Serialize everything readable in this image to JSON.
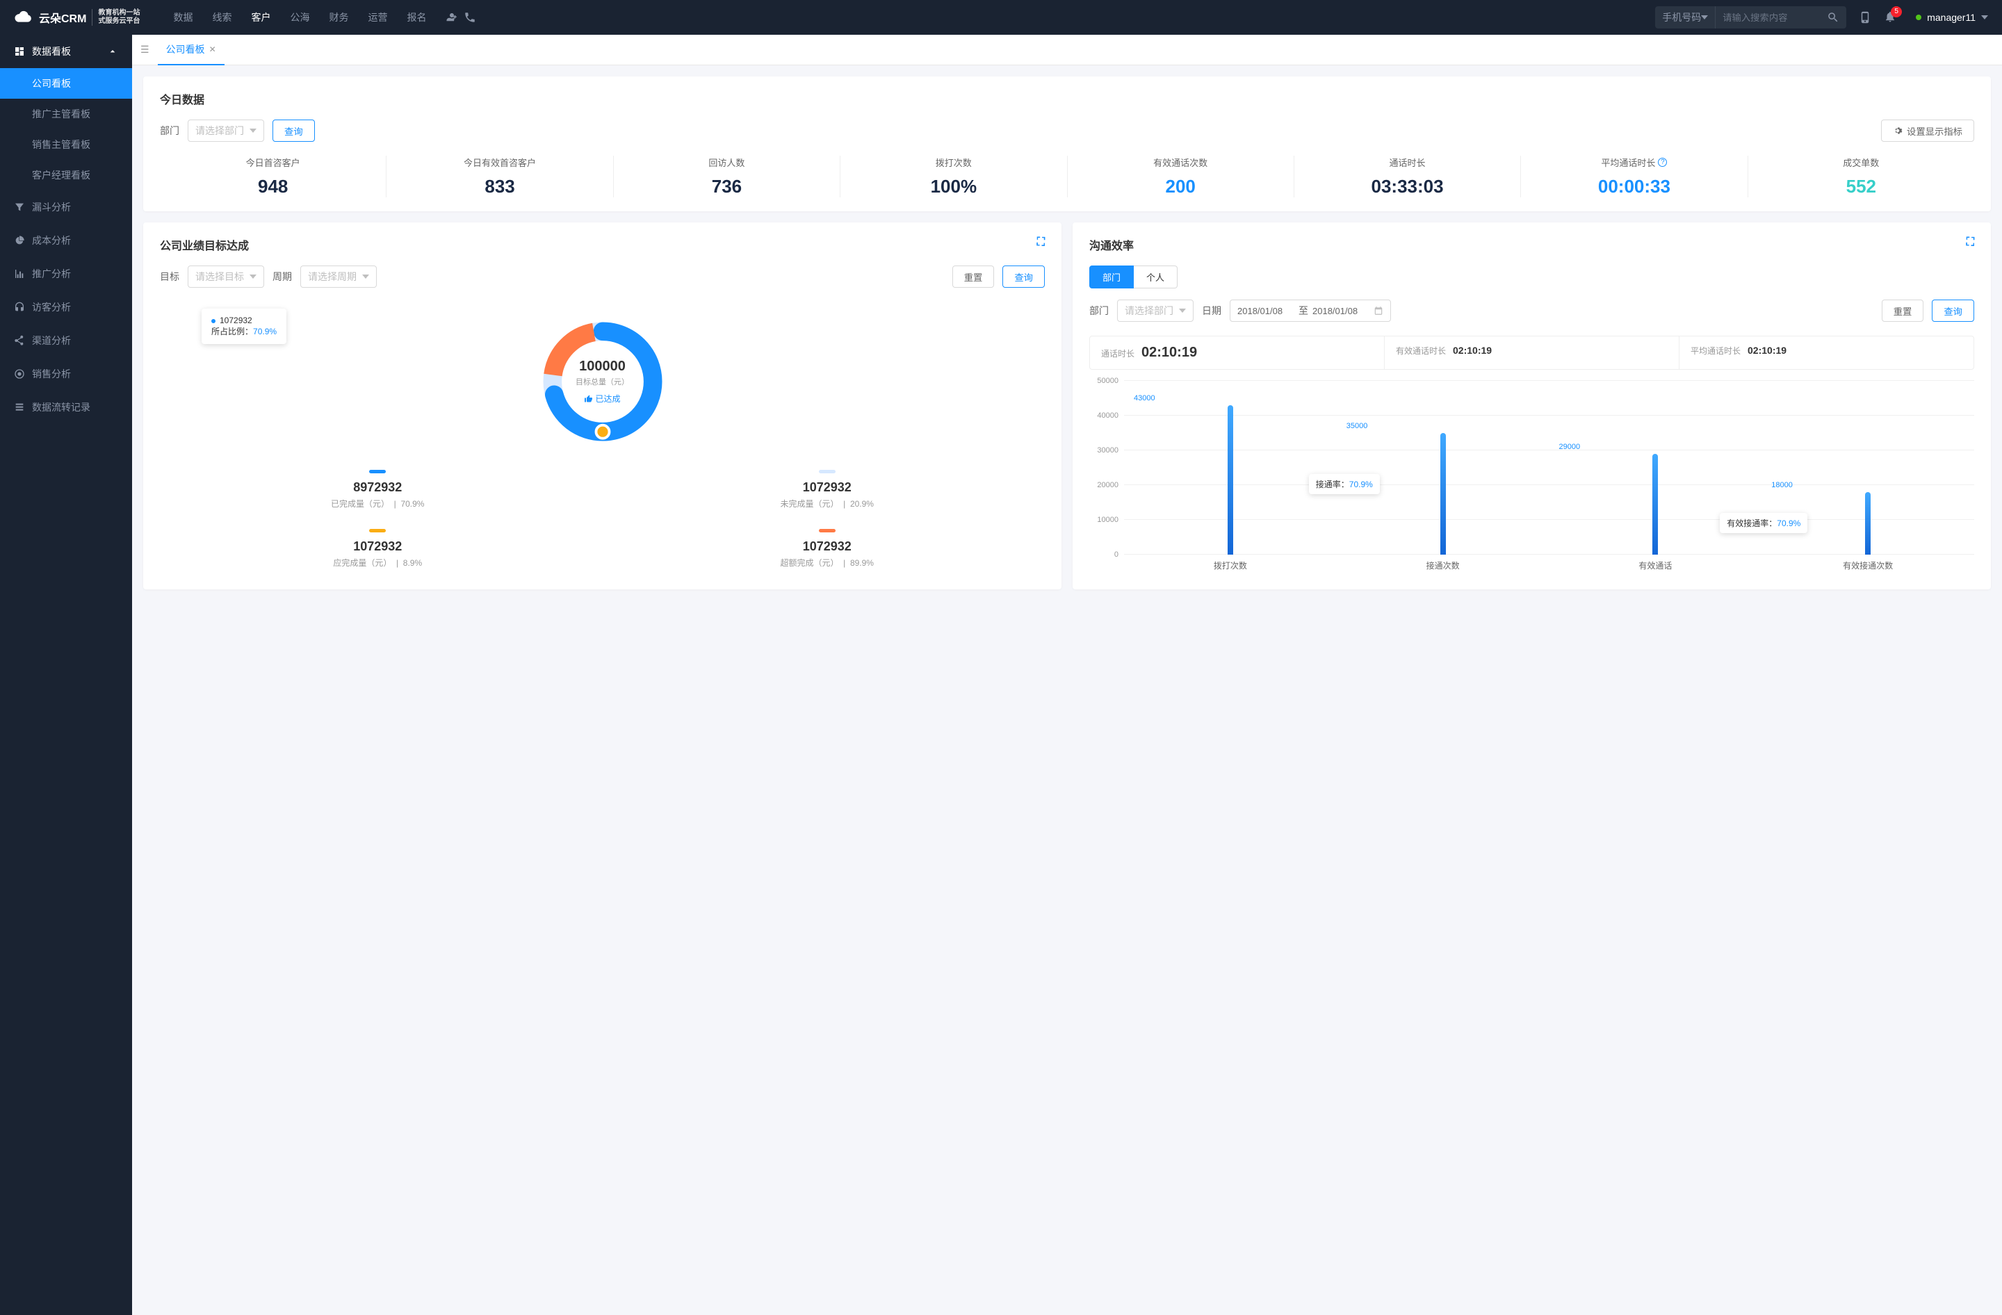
{
  "header": {
    "logo": "云朵CRM",
    "logo_url_hint": "www.yunduocrm.com",
    "logo_sub1": "教育机构一站",
    "logo_sub2": "式服务云平台",
    "nav": [
      "数据",
      "线索",
      "客户",
      "公海",
      "财务",
      "运营",
      "报名"
    ],
    "nav_active": 2,
    "search_select": "手机号码",
    "search_placeholder": "请输入搜索内容",
    "notification_count": "5",
    "username": "manager11"
  },
  "sidebar": {
    "group_label": "数据看板",
    "items": [
      "公司看板",
      "推广主管看板",
      "销售主管看板",
      "客户经理看板"
    ],
    "active_index": 0,
    "singles": [
      "漏斗分析",
      "成本分析",
      "推广分析",
      "访客分析",
      "渠道分析",
      "销售分析",
      "数据流转记录"
    ]
  },
  "tabs": {
    "active": "公司看板"
  },
  "today": {
    "title": "今日数据",
    "dept_label": "部门",
    "dept_placeholder": "请选择部门",
    "query": "查询",
    "settings": "设置显示指标",
    "stats": [
      {
        "label": "今日首咨客户",
        "value": "948",
        "cls": "navy"
      },
      {
        "label": "今日有效首咨客户",
        "value": "833",
        "cls": "navy"
      },
      {
        "label": "回访人数",
        "value": "736",
        "cls": "navy"
      },
      {
        "label": "拨打次数",
        "value": "100%",
        "cls": "navy"
      },
      {
        "label": "有效通话次数",
        "value": "200",
        "cls": "blue"
      },
      {
        "label": "通话时长",
        "value": "03:33:03",
        "cls": "navy"
      },
      {
        "label": "平均通话时长",
        "value": "00:00:33",
        "cls": "blue",
        "info": true
      },
      {
        "label": "成交单数",
        "value": "552",
        "cls": "cyan"
      }
    ]
  },
  "goal": {
    "title": "公司业绩目标达成",
    "target_label": "目标",
    "target_placeholder": "请选择目标",
    "period_label": "周期",
    "period_placeholder": "请选择周期",
    "reset": "重置",
    "query": "查询",
    "tooltip_value": "1072932",
    "tooltip_ratio_label": "所占比例：",
    "tooltip_ratio": "70.9%",
    "center_value": "100000",
    "center_label": "目标总量（元）",
    "achieved": "已达成",
    "legend": [
      {
        "color": "#1890ff",
        "value": "8972932",
        "label": "已完成量（元）",
        "pct": "70.9%"
      },
      {
        "color": "#d6e8ff",
        "value": "1072932",
        "label": "未完成量（元）",
        "pct": "20.9%"
      },
      {
        "color": "#faad14",
        "value": "1072932",
        "label": "应完成量（元）",
        "pct": "8.9%"
      },
      {
        "color": "#ff7a45",
        "value": "1072932",
        "label": "超额完成（元）",
        "pct": "89.9%"
      }
    ]
  },
  "comm": {
    "title": "沟通效率",
    "tab_dept": "部门",
    "tab_person": "个人",
    "dept_label": "部门",
    "dept_placeholder": "请选择部门",
    "date_label": "日期",
    "date_from": "2018/01/08",
    "date_to": "2018/01/08",
    "date_sep": "至",
    "reset": "重置",
    "query": "查询",
    "metrics": [
      {
        "label": "通话时长",
        "value": "02:10:19"
      },
      {
        "label": "有效通话时长",
        "value": "02:10:19"
      },
      {
        "label": "平均通话时长",
        "value": "02:10:19"
      }
    ],
    "bar_tooltip1_label": "接通率：",
    "bar_tooltip1_value": "70.9%",
    "bar_tooltip2_label": "有效接通率：",
    "bar_tooltip2_value": "70.9%"
  },
  "chart_data": [
    {
      "type": "pie",
      "title": "公司业绩目标达成",
      "center_value": 100000,
      "series": [
        {
          "name": "已完成量（元）",
          "value": 8972932,
          "pct": 70.9,
          "color": "#1890ff"
        },
        {
          "name": "未完成量（元）",
          "value": 1072932,
          "pct": 20.9,
          "color": "#d6e8ff"
        },
        {
          "name": "应完成量（元）",
          "value": 1072932,
          "pct": 8.9,
          "color": "#faad14"
        },
        {
          "name": "超额完成（元）",
          "value": 1072932,
          "pct": 89.9,
          "color": "#ff7a45"
        }
      ]
    },
    {
      "type": "bar",
      "title": "沟通效率",
      "categories": [
        "拨打次数",
        "接通次数",
        "有效通话",
        "有效接通次数"
      ],
      "values": [
        43000,
        35000,
        29000,
        18000
      ],
      "ylabel": "",
      "ylim": [
        0,
        50000
      ],
      "y_ticks": [
        0,
        10000,
        20000,
        30000,
        40000,
        50000
      ],
      "annotations": [
        {
          "category": "接通次数",
          "label": "接通率",
          "value": "70.9%"
        },
        {
          "category": "有效接通次数",
          "label": "有效接通率",
          "value": "70.9%"
        }
      ]
    }
  ]
}
